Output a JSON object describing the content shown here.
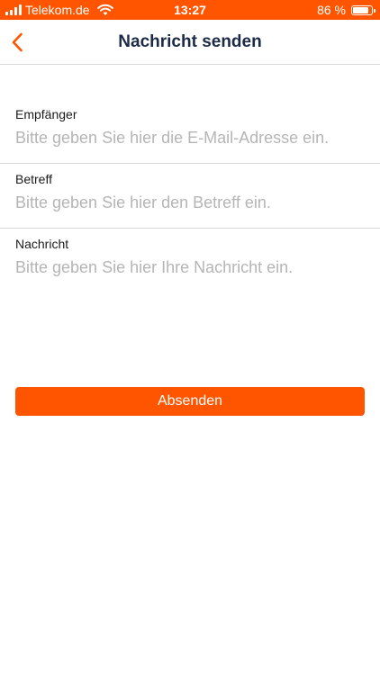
{
  "status_bar": {
    "carrier": "Telekom.de",
    "time": "13:27",
    "battery_percent": "86 %",
    "battery_level": 0.86
  },
  "nav": {
    "title": "Nachricht senden"
  },
  "form": {
    "recipient": {
      "label": "Empfänger",
      "value": "",
      "placeholder": "Bitte geben Sie hier die E-Mail-Adresse ein."
    },
    "subject": {
      "label": "Betreff",
      "value": "",
      "placeholder": "Bitte geben Sie hier den Betreff ein."
    },
    "message": {
      "label": "Nachricht",
      "value": "",
      "placeholder": "Bitte geben Sie hier Ihre Nachricht ein."
    }
  },
  "actions": {
    "send_label": "Absenden"
  },
  "colors": {
    "accent": "#ff5500",
    "title": "#1c2a47",
    "placeholder": "#b5b5b5"
  },
  "icons": {
    "back": "chevron-left-icon",
    "signal": "cellular-signal-icon",
    "wifi": "wifi-icon",
    "battery": "battery-icon"
  }
}
